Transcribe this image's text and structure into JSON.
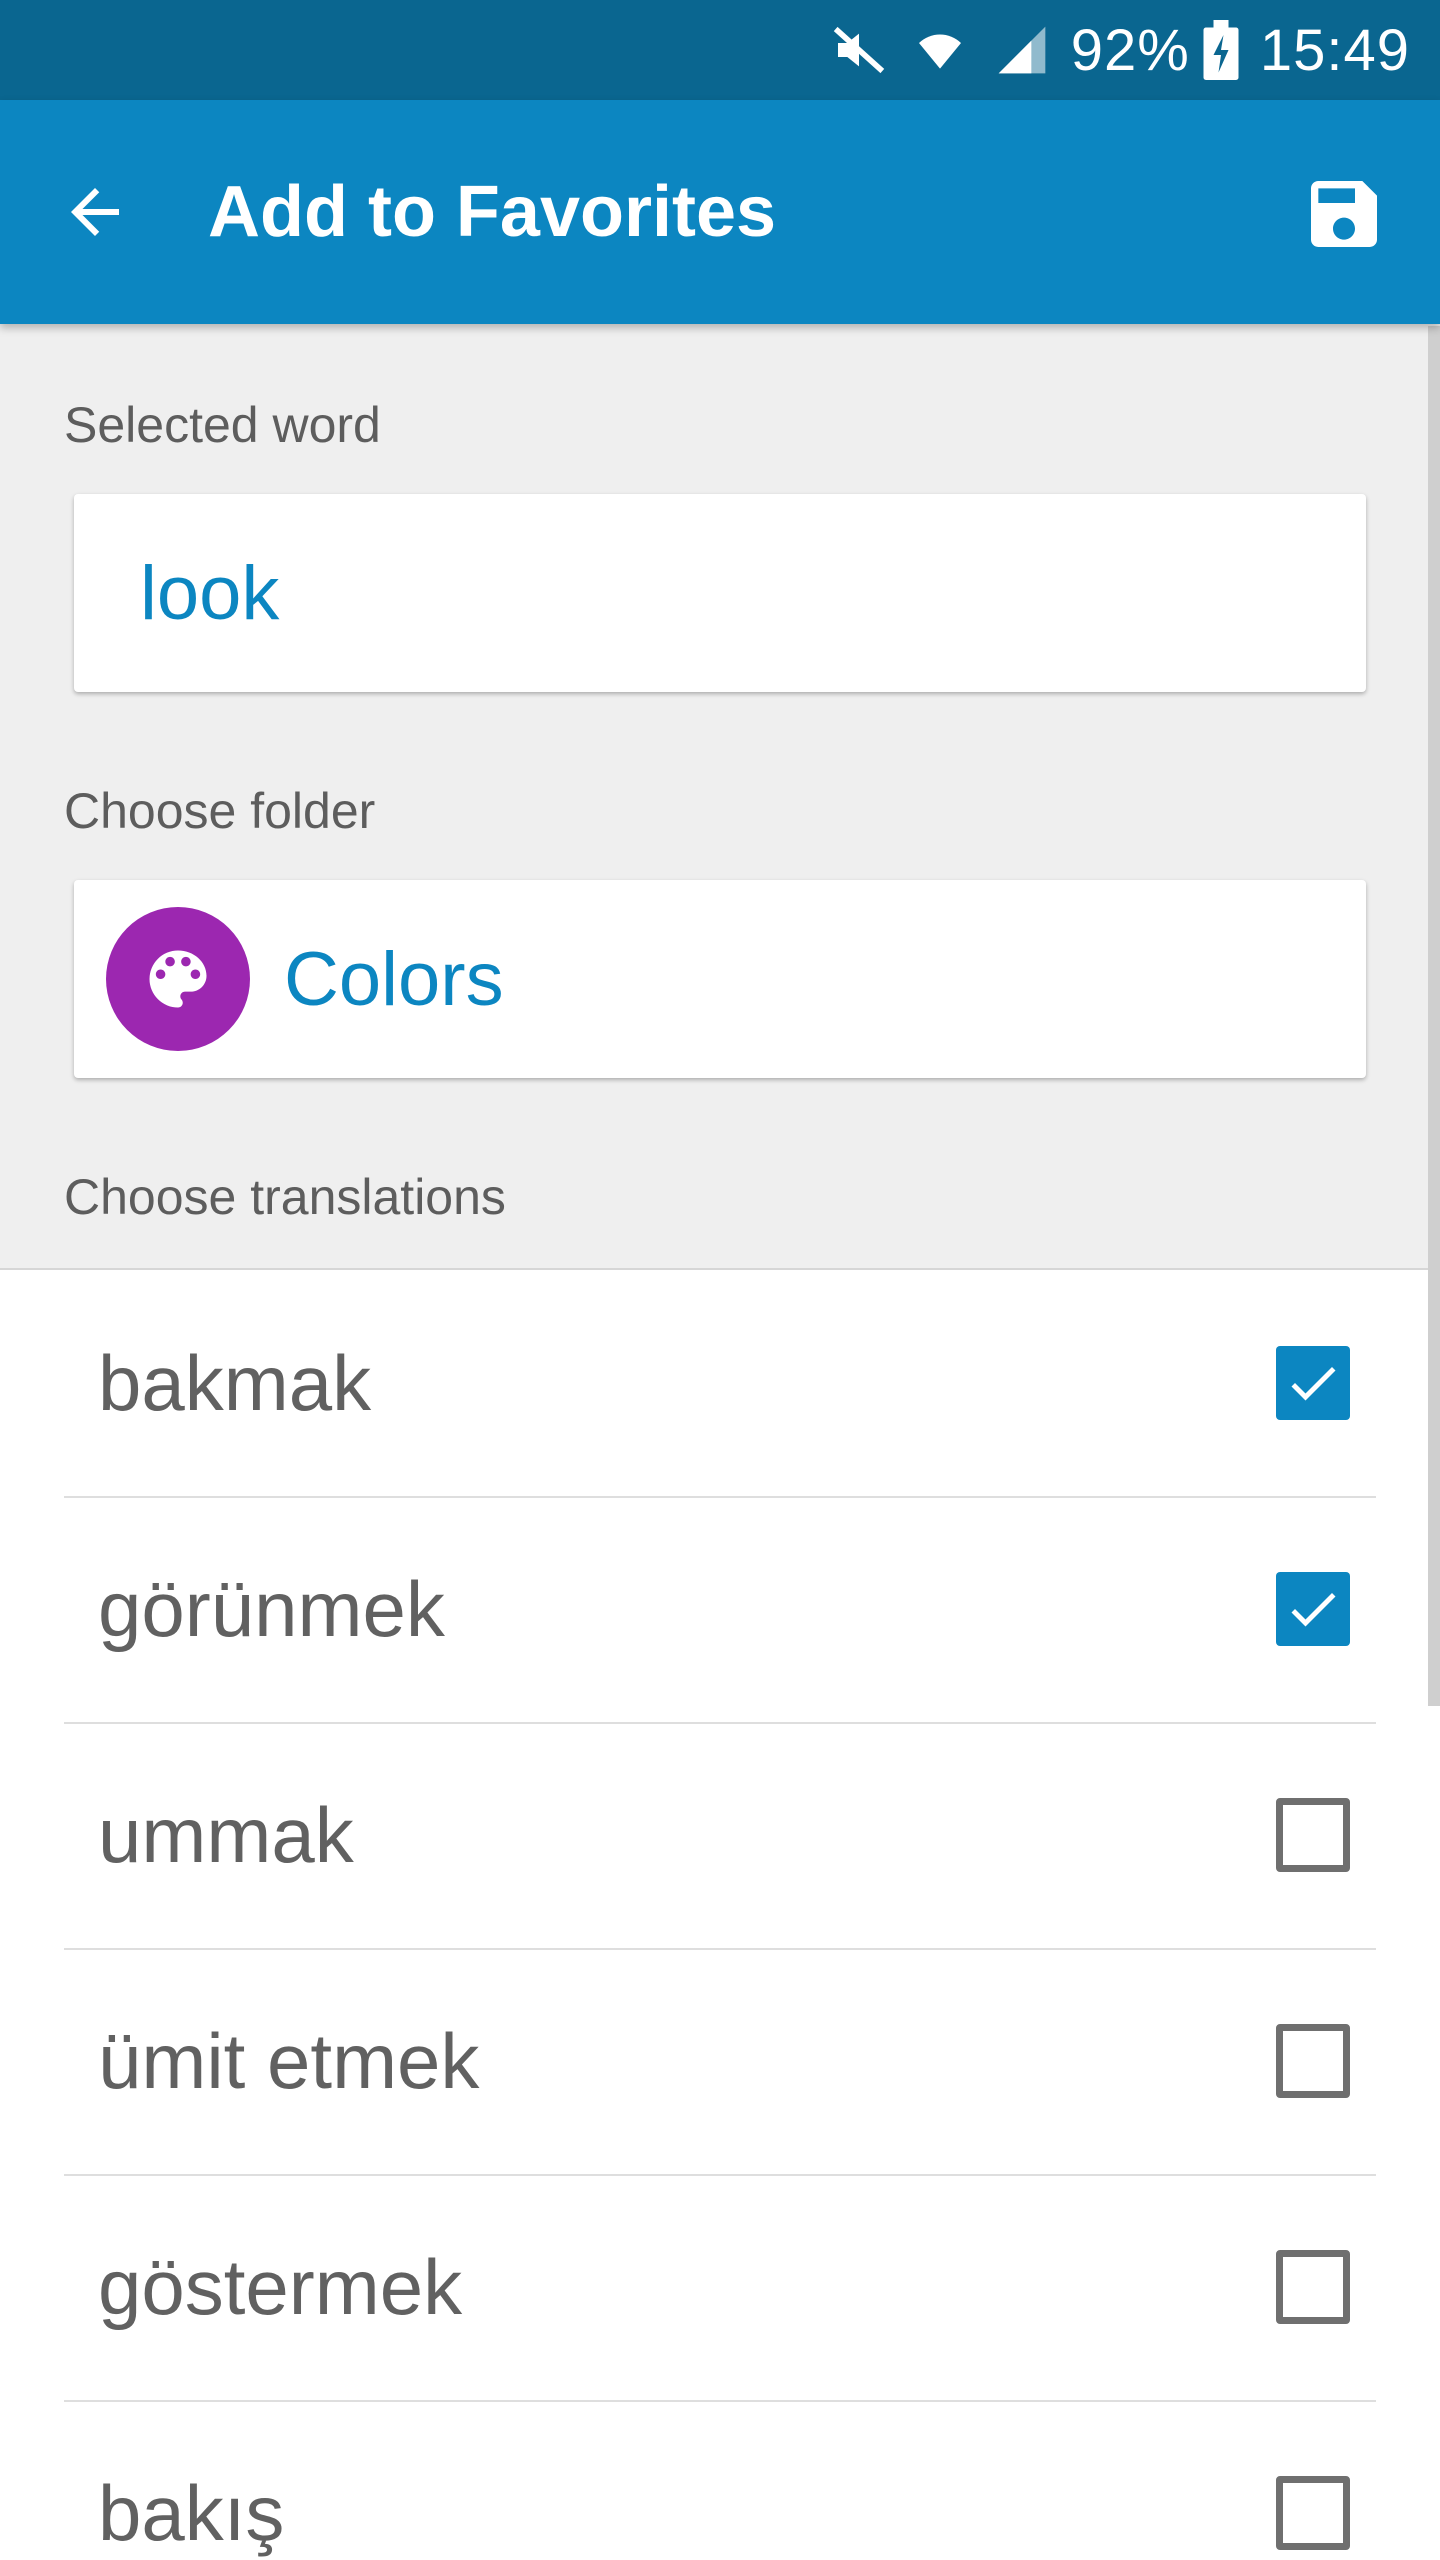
{
  "status_bar": {
    "battery": "92%",
    "time": "15:49",
    "icons": [
      "mute-icon",
      "wifi-icon",
      "signal-icon",
      "battery-charging-icon"
    ]
  },
  "app_bar": {
    "title": "Add to Favorites",
    "back_icon": "arrow-left-icon",
    "save_icon": "floppy-disk-icon",
    "color": "#0c86c1"
  },
  "form": {
    "selected_word_label": "Selected word",
    "selected_word_value": "look",
    "choose_folder_label": "Choose folder",
    "folder": {
      "name": "Colors",
      "icon": "palette-icon",
      "color": "#9c27b0"
    },
    "choose_translations_label": "Choose translations"
  },
  "translations": [
    {
      "label": "bakmak",
      "checked": true
    },
    {
      "label": "görünmek",
      "checked": true
    },
    {
      "label": "ummak",
      "checked": false
    },
    {
      "label": "ümit etmek",
      "checked": false
    },
    {
      "label": "göstermek",
      "checked": false
    },
    {
      "label": "bakış",
      "checked": false
    }
  ],
  "colors": {
    "status_bar": "#0a6690",
    "accent": "#0c86c1",
    "folder": "#9c27b0"
  }
}
